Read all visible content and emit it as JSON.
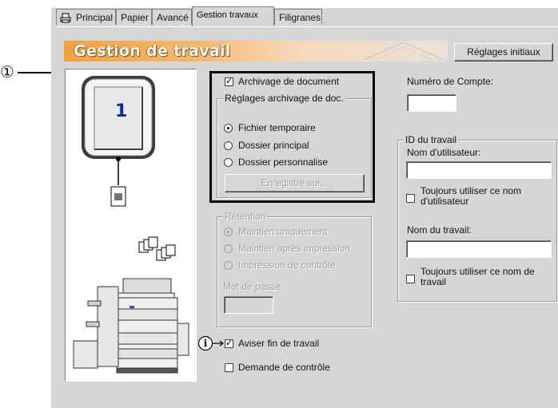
{
  "callout": {
    "number": "①"
  },
  "tabs": [
    {
      "label": "Principal"
    },
    {
      "label": "Papier"
    },
    {
      "label": "Avancé"
    },
    {
      "label": "Gestion travaux"
    },
    {
      "label": "Filigranes"
    }
  ],
  "banner": {
    "title": "Gestion de travail",
    "reset_button": "Réglages initiaux"
  },
  "preview": {
    "page_number": "1"
  },
  "archive": {
    "archive_checkbox": {
      "label": "Archivage de document",
      "checked": true
    },
    "group_title": "Réglages archivage de doc.",
    "options": [
      {
        "label": "Fichier temporaire",
        "selected": true
      },
      {
        "label": "Dossier principal",
        "selected": false
      },
      {
        "label": "Dossier personnalise",
        "selected": false
      }
    ],
    "saved_button": "Enregistré sur..."
  },
  "retention": {
    "group_title": "Rétention",
    "options": [
      {
        "label": "Maintien uniquement",
        "selected": true
      },
      {
        "label": "Maintien après impression",
        "selected": false
      },
      {
        "label": "Impression de contrôle",
        "selected": false
      }
    ],
    "password_label": "Mot de passe",
    "password_value": ""
  },
  "notify": {
    "end_job": {
      "label": "Aviser fin de travail",
      "checked": true
    },
    "check_request": {
      "label": "Demande de contrôle",
      "checked": false
    }
  },
  "account": {
    "label": "Numéro de Compte:",
    "value": ""
  },
  "job_id": {
    "group_title": "ID du travail",
    "username_label": "Nom d'utilisateur:",
    "username_value": "",
    "always_username": "Toujours utiliser ce nom d'utilisateur",
    "job_name_label": "Nom du travail:",
    "job_name_value": "",
    "always_job_name": "Toujours utiliser ce nom de travail"
  },
  "colors": {
    "banner_start": "#f0a040",
    "dialog_bg": "#d6d6d6",
    "highlight_border": "#000000"
  }
}
